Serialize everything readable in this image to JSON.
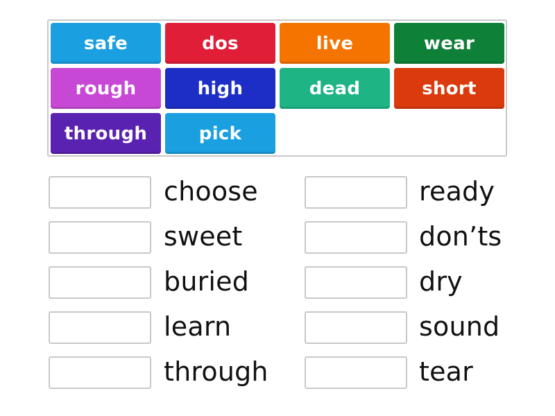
{
  "tiles": [
    {
      "label": "safe",
      "color": "#1aa0e0"
    },
    {
      "label": "dos",
      "color": "#e01e38"
    },
    {
      "label": "live",
      "color": "#f57400"
    },
    {
      "label": "wear",
      "color": "#0e8038"
    },
    {
      "label": "rough",
      "color": "#c848d6"
    },
    {
      "label": "high",
      "color": "#1c2ec6"
    },
    {
      "label": "dead",
      "color": "#1eb484"
    },
    {
      "label": "short",
      "color": "#da3a0c"
    },
    {
      "label": "through",
      "color": "#5a22b0"
    },
    {
      "label": "pick",
      "color": "#1aa0e0"
    }
  ],
  "targets": [
    {
      "word": "choose"
    },
    {
      "word": "sweet"
    },
    {
      "word": "buried"
    },
    {
      "word": "learn"
    },
    {
      "word": "through"
    },
    {
      "word": "ready"
    },
    {
      "word": "don’ts"
    },
    {
      "word": "dry"
    },
    {
      "word": "sound"
    },
    {
      "word": "tear"
    }
  ]
}
